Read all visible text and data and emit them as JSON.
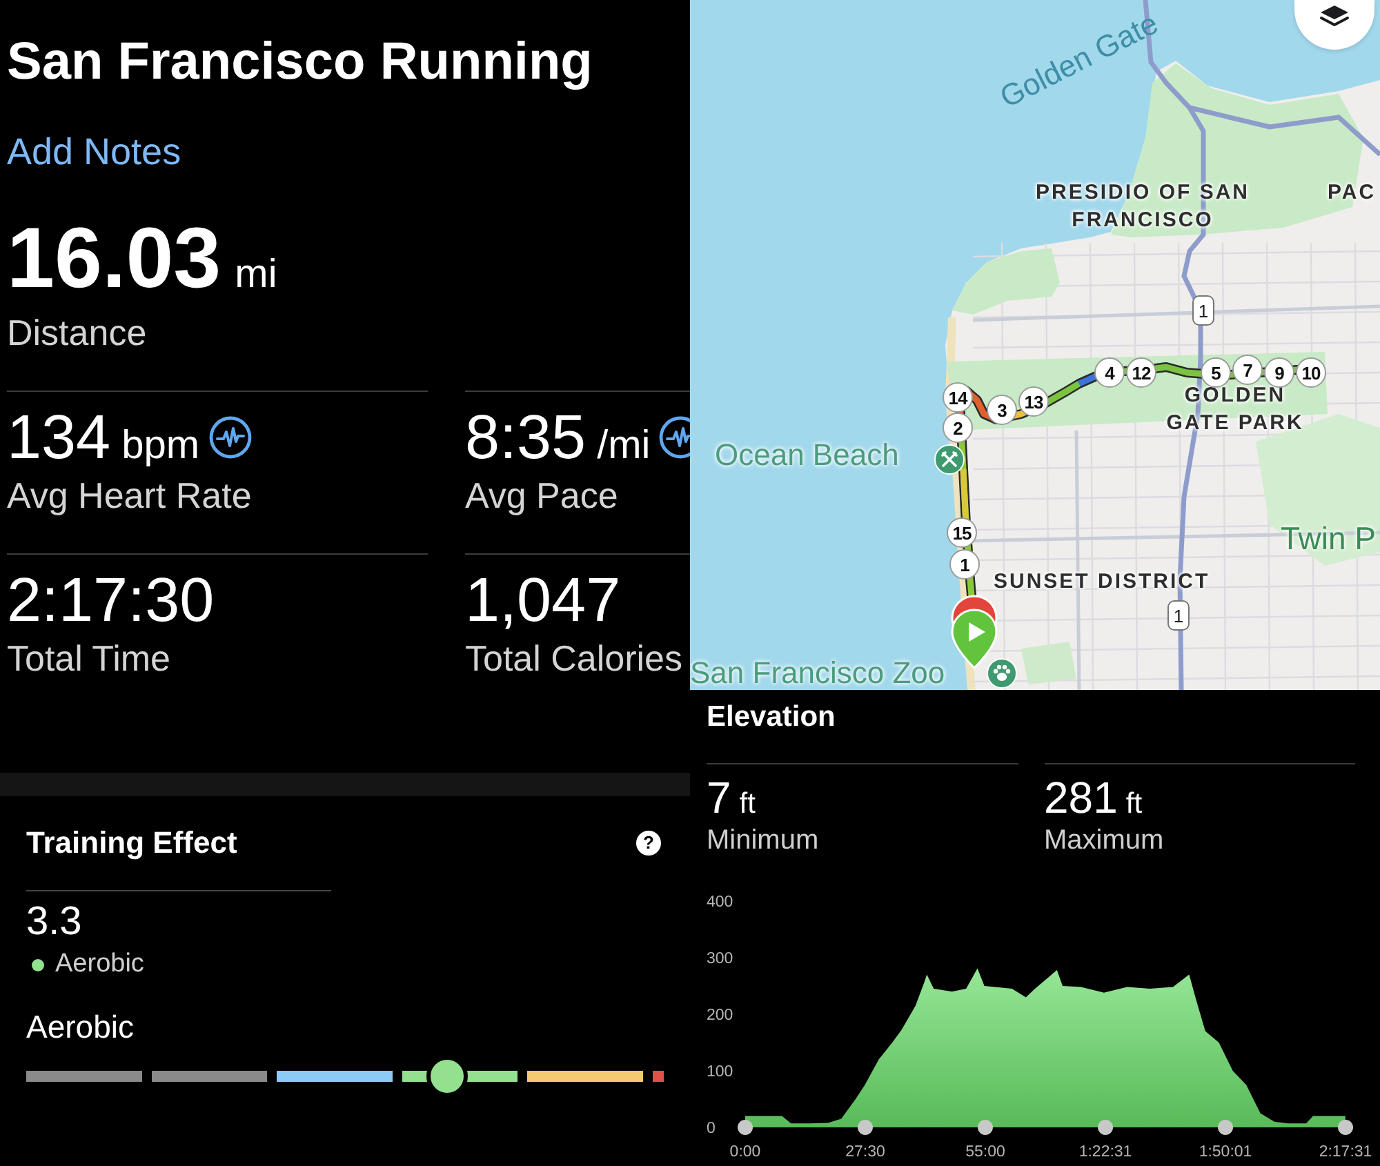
{
  "activity": {
    "title": "San Francisco Running",
    "notes_link": "Add Notes"
  },
  "distance": {
    "value": "16.03",
    "unit": "mi",
    "label": "Distance"
  },
  "stats": [
    {
      "value": "134",
      "unit": "bpm",
      "label": "Avg Heart Rate",
      "chart_link": true
    },
    {
      "value": "8:35",
      "unit": "/mi",
      "label": "Avg Pace",
      "chart_link": true
    },
    {
      "value": "2:17:30",
      "label": "Total Time",
      "chart_link": false
    },
    {
      "value": "1,047",
      "label": "Total Calories",
      "chart_link": false
    }
  ],
  "training_effect": {
    "title": "Training Effect",
    "help": "?",
    "score": "3.3",
    "score_label": "Aerobic",
    "scale_label": "Aerobic",
    "scale": {
      "level": 0.66
    }
  },
  "map": {
    "labels": [
      {
        "text": "Golden Gate",
        "kind": "water"
      },
      {
        "text": "PRESIDIO OF SAN FRANCISCO",
        "kind": "district"
      },
      {
        "text": "PAC",
        "kind": "district"
      },
      {
        "text": "GOLDEN GATE PARK",
        "kind": "district"
      },
      {
        "text": "Ocean Beach",
        "kind": "poi"
      },
      {
        "text": "Twin P",
        "kind": "area"
      },
      {
        "text": "SUNSET DISTRICT",
        "kind": "district"
      },
      {
        "text": "San Francisco Zoo",
        "kind": "poi"
      }
    ],
    "mile_markers": [
      "14",
      "2",
      "3",
      "13",
      "4",
      "12",
      "5",
      "7",
      "9",
      "10",
      "15",
      "1"
    ],
    "highway_shields": [
      "1",
      "1"
    ]
  },
  "elevation": {
    "title": "Elevation",
    "stats": [
      {
        "value": "7",
        "unit": "ft",
        "label": "Minimum"
      },
      {
        "value": "281",
        "unit": "ft",
        "label": "Maximum"
      }
    ],
    "chart_data": {
      "type": "area",
      "x": [
        0,
        8.4,
        10.5,
        14.8,
        19,
        22,
        25.3,
        27.4,
        30.6,
        33.7,
        35.8,
        39,
        41.1,
        41.6,
        43.2,
        47.4,
        50.6,
        53.2,
        54.8,
        61.1,
        64.3,
        66.4,
        71.4,
        72.7,
        76.9,
        82.2,
        87.5,
        92.7,
        98,
        101.7,
        103.3,
        105.4,
        108.5,
        111.7,
        114.8,
        118,
        121.2,
        124.3,
        128.5,
        130.1,
        137.5
      ],
      "values": [
        20,
        20,
        7,
        7,
        8,
        15,
        50,
        75,
        120,
        150,
        172,
        215,
        258,
        270,
        245,
        240,
        245,
        281,
        250,
        245,
        230,
        245,
        278,
        250,
        248,
        238,
        248,
        245,
        248,
        270,
        225,
        170,
        150,
        100,
        75,
        25,
        10,
        7,
        7,
        20,
        20
      ],
      "xlim": [
        0,
        137.52
      ],
      "ylim": [
        0,
        400
      ],
      "yticks": [
        0,
        100,
        200,
        300,
        400
      ],
      "xticks": [
        {
          "value": 0,
          "label": "0:00"
        },
        {
          "value": 27.5,
          "label": "27:30"
        },
        {
          "value": 55,
          "label": "55:00"
        },
        {
          "value": 82.52,
          "label": "1:22:31"
        },
        {
          "value": 110.02,
          "label": "1:50:01"
        },
        {
          "value": 137.52,
          "label": "2:17:31"
        }
      ]
    }
  }
}
